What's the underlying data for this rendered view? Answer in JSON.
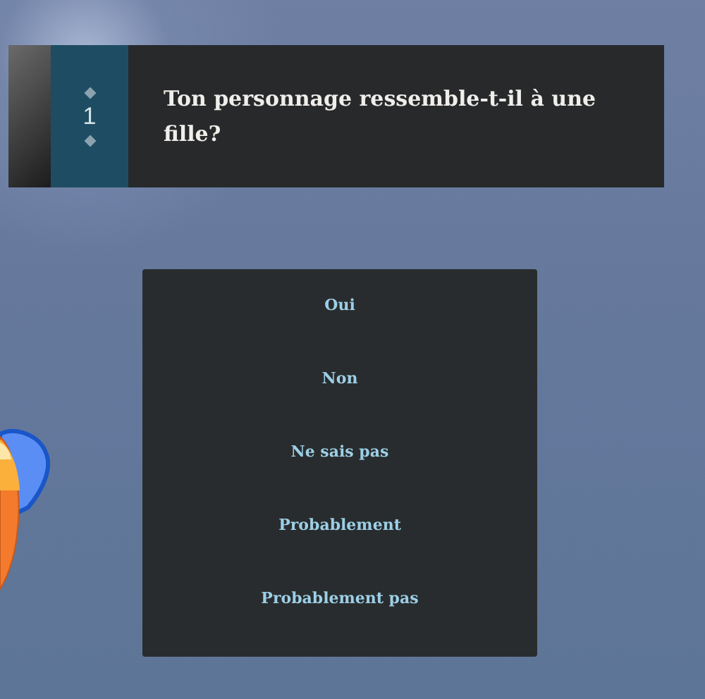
{
  "question": {
    "number": "1",
    "text": "Ton personnage ressemble-t-il à une fille?"
  },
  "answers": [
    {
      "label": "Oui"
    },
    {
      "label": "Non"
    },
    {
      "label": "Ne sais pas"
    },
    {
      "label": "Probablement"
    },
    {
      "label": "Probablement pas"
    }
  ]
}
